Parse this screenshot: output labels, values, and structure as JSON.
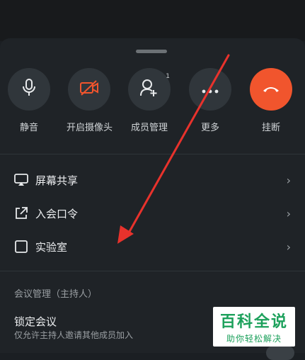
{
  "actions": [
    {
      "label": "静音",
      "icon": "microphone-icon"
    },
    {
      "label": "开启摄像头",
      "icon": "camera-off-icon"
    },
    {
      "label": "成员管理",
      "icon": "add-member-icon",
      "badge": "1"
    },
    {
      "label": "更多",
      "icon": "more-icon"
    },
    {
      "label": "挂断",
      "icon": "hang-up-icon",
      "color": "#f1552d"
    }
  ],
  "menu": [
    {
      "label": "屏幕共享",
      "icon": "screen-share-icon"
    },
    {
      "label": "入会口令",
      "icon": "external-link-icon"
    },
    {
      "label": "实验室",
      "icon": "checkbox-icon"
    }
  ],
  "host_section": {
    "title": "会议管理（主持人）",
    "lock_title": "锁定会议",
    "lock_desc": "仅允许主持人邀请其他成员加入"
  },
  "watermark": {
    "line1": "百科全说",
    "line2": "助你轻松解决"
  },
  "colors": {
    "accent_red": "#f1552d",
    "arrow_red": "#e8322c",
    "watermark_green": "#1da15c"
  }
}
